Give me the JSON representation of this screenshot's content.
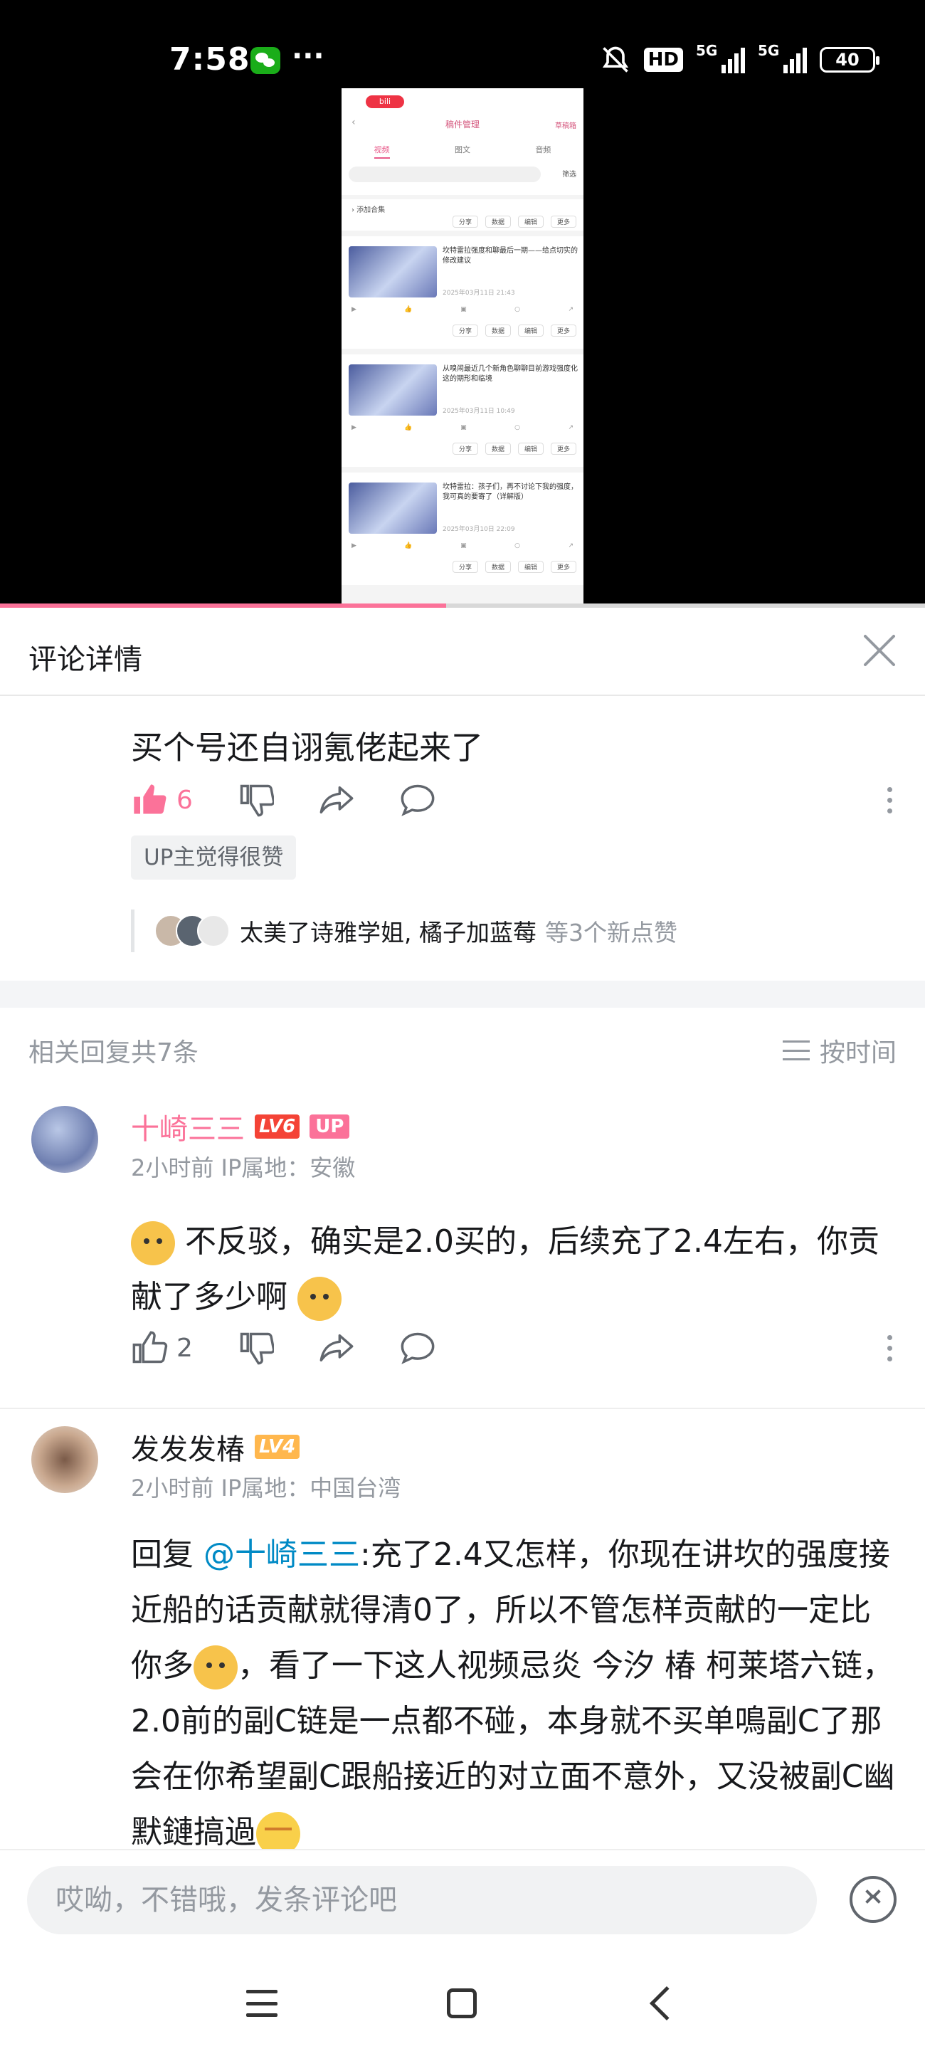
{
  "status_bar": {
    "time": "7:58",
    "dots": "···",
    "hd": "HD",
    "net1": "5G",
    "net2": "5G",
    "battery": "40"
  },
  "video": {
    "progress": 0.482,
    "mock": {
      "title": "稿件管理",
      "draft": "草稿箱",
      "tabs": [
        "视频",
        "图文",
        "音频"
      ],
      "filter": "筛选",
      "add_collection": "› 添加合集",
      "buttons": [
        "分享",
        "数据",
        "编辑",
        "更多"
      ],
      "cards": [
        {
          "caption": "坎特雷拉强度和聊最后一期——给点切实的修改建议",
          "date": "2025年03月11日 21:43"
        },
        {
          "caption": "从嗅闹最近几个新角色聊聊目前游戏强度化这的期形和临境",
          "date": "2025年03月11日 10:49"
        },
        {
          "caption": "坎特雷拉：孩子们，再不讨论下我的强度，我可真的要寄了（详解版）",
          "date": "2025年03月10日 22:09"
        }
      ]
    }
  },
  "panel": {
    "title": "评论详情",
    "main_comment": {
      "text": "买个号还自诩氪佬起来了",
      "like_count": "6",
      "up_badge": "UP主觉得很赞",
      "likers_names": "太美了诗雅学姐, 橘子加蓝莓",
      "likers_rest": "等3个新点赞"
    },
    "replies_header": {
      "count": "相关回复共7条",
      "sort": "按时间"
    },
    "replies": [
      {
        "username": "十崎三三",
        "level": "LV6",
        "up_tag": "UP",
        "meta": "2小时前  IP属地：安徽",
        "text_a": "不反驳，确实是2.0买的，后续充了2.4左右，你贡献了多少啊",
        "like_count": "2"
      },
      {
        "username": "发发发椿",
        "level": "LV4",
        "meta": "2小时前  IP属地：中国台湾",
        "reply_prefix": "回复 ",
        "mention": "@十崎三三",
        "text_a": ":充了2.4又怎样，你现在讲坎的强度接近船的话贡献就得清0了，所以不管怎样贡献的一定比你多",
        "text_b": "，看了一下这人视频忌炎 今汐 椿 柯莱塔六链，2.0前的副C链是一点都不碰，本身就不买单鳴副C了那会在你希望副C跟船接近的对立面不意外，又没被副C幽默鏈搞過"
      }
    ],
    "input_placeholder": "哎呦，不错哦，发条评论吧"
  },
  "colors": {
    "accent": "#fb7299",
    "mention": "#008ac5",
    "lv6": "#f44336",
    "lv4": "#ffb74d"
  }
}
